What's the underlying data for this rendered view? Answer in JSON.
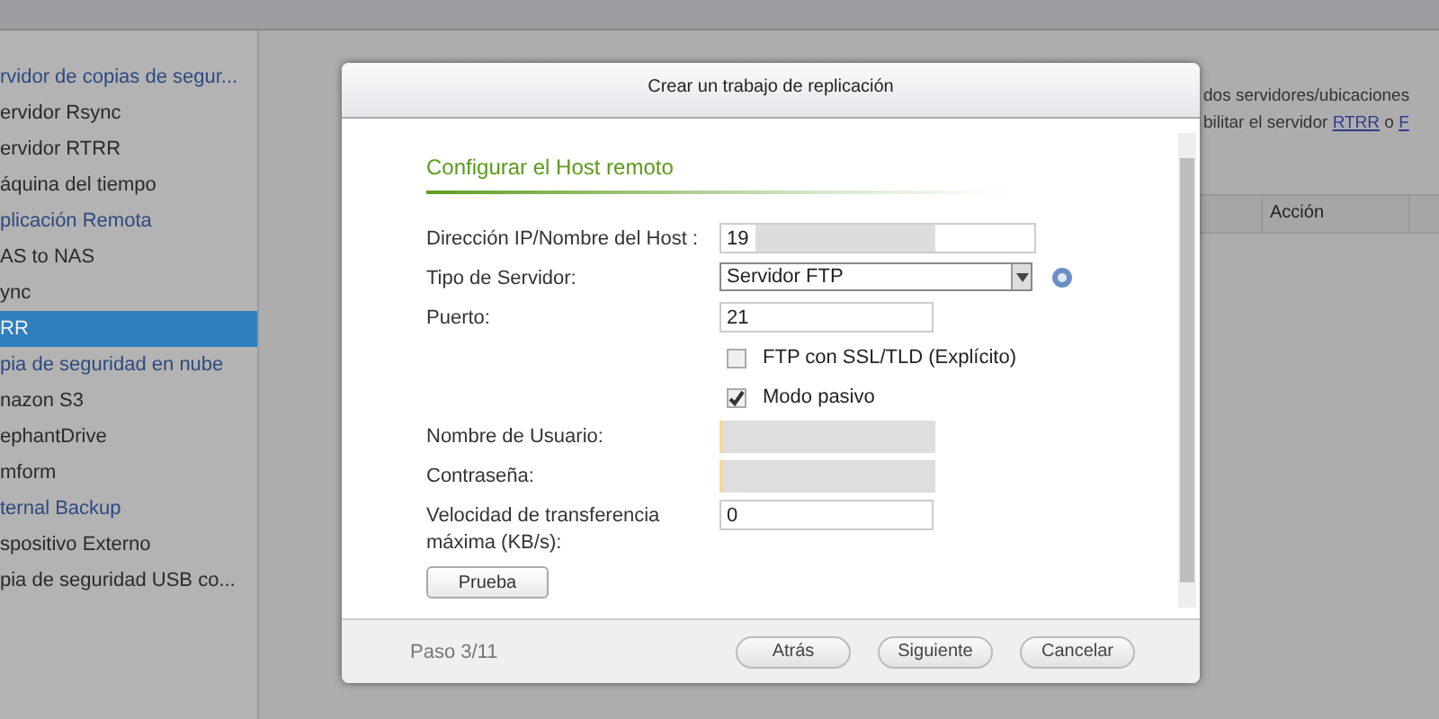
{
  "sidebar": {
    "items": [
      {
        "label": "rvidor de copias de segur...",
        "kind": "heading",
        "selected": false
      },
      {
        "label": "ervidor Rsync",
        "kind": "item",
        "selected": false
      },
      {
        "label": "ervidor RTRR",
        "kind": "item",
        "selected": false
      },
      {
        "label": "áquina del tiempo",
        "kind": "item",
        "selected": false
      },
      {
        "label": "plicación Remota",
        "kind": "heading",
        "selected": false
      },
      {
        "label": "AS to NAS",
        "kind": "item",
        "selected": false
      },
      {
        "label": "ync",
        "kind": "item",
        "selected": false
      },
      {
        "label": "RR",
        "kind": "item",
        "selected": true
      },
      {
        "label": "pia de seguridad en nube",
        "kind": "heading",
        "selected": false
      },
      {
        "label": "nazon S3",
        "kind": "item",
        "selected": false
      },
      {
        "label": "ephantDrive",
        "kind": "item",
        "selected": false
      },
      {
        "label": "mform",
        "kind": "item",
        "selected": false
      },
      {
        "label": "ternal Backup",
        "kind": "heading",
        "selected": false
      },
      {
        "label": "spositivo Externo",
        "kind": "item",
        "selected": false
      },
      {
        "label": "pia de seguridad USB co...",
        "kind": "item",
        "selected": false
      }
    ]
  },
  "main": {
    "description": [
      [
        {
          "kind": "text",
          "text": "dos servidores/ubicaciones"
        }
      ],
      [
        {
          "kind": "text",
          "text": "bilitar el servidor "
        },
        {
          "kind": "link",
          "text": "RTRR"
        },
        {
          "kind": "text",
          "text": " o "
        },
        {
          "kind": "link",
          "text": "F"
        }
      ]
    ],
    "table": {
      "columns": [
        "",
        "Acción"
      ]
    }
  },
  "dialog": {
    "title": "Crear un trabajo de replicación",
    "section": "Configurar el Host remoto",
    "fields": [
      {
        "kind": "host",
        "label": "Dirección IP/Nombre del Host :",
        "value": "19"
      },
      {
        "kind": "select",
        "label": "Tipo de Servidor:",
        "value": "Servidor FTP"
      },
      {
        "kind": "text",
        "label": "Puerto:",
        "value": "21"
      },
      {
        "kind": "checkbox",
        "label": "FTP con SSL/TLD (Explícito)",
        "checked": false
      },
      {
        "kind": "checkbox",
        "label": "Modo pasivo",
        "checked": true
      },
      {
        "kind": "hidden",
        "label": "Nombre de Usuario:"
      },
      {
        "kind": "hidden",
        "label": "Contraseña:"
      },
      {
        "kind": "text",
        "label": "Velocidad de transferencia máxima (KB/s):",
        "value": "0"
      }
    ],
    "test_button": "Prueba",
    "step": "Paso 3/11",
    "buttons": [
      "Atrás",
      "Siguiente",
      "Cancelar"
    ]
  }
}
